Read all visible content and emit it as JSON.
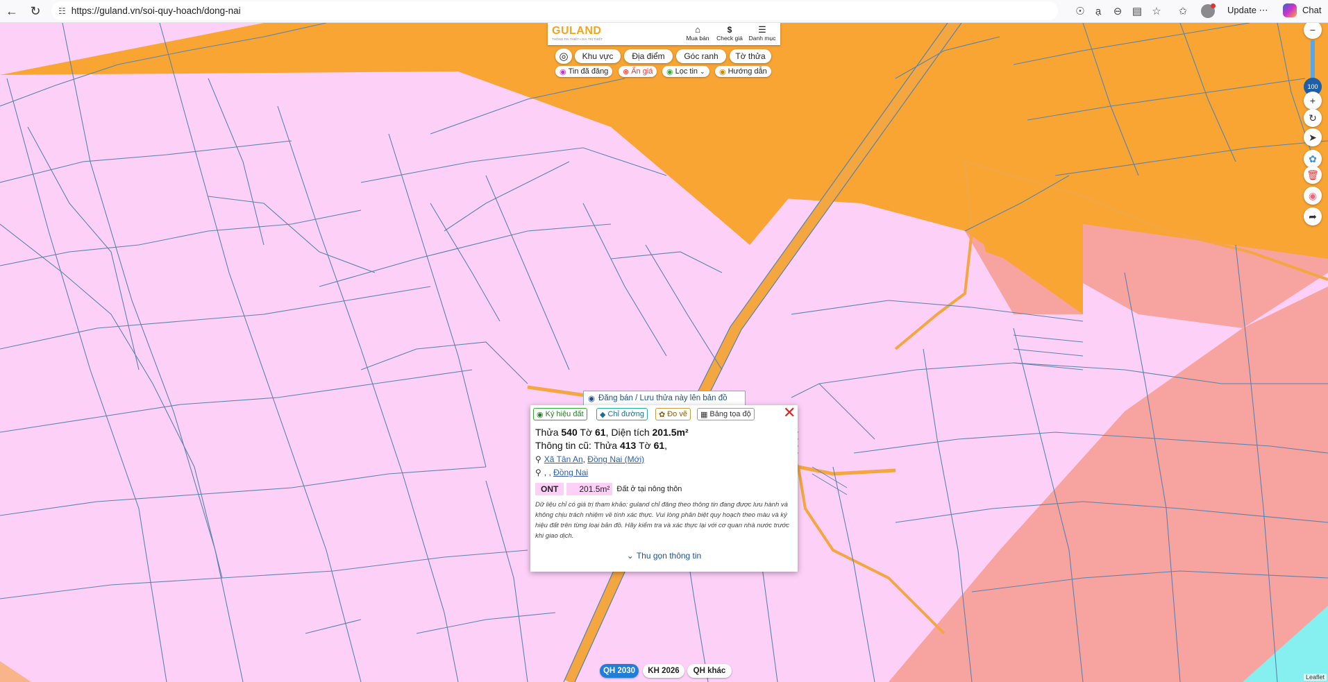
{
  "browser": {
    "url": "https://guland.vn/soi-quy-hoach/dong-nai",
    "update_label": "Update",
    "chat_label": "Chat"
  },
  "header": {
    "logo_text": "GULAND",
    "logo_sub": "THÔNG TIN THIẾT • GIÁ TRỊ THIẾT",
    "menu": [
      {
        "icon": "house-icon",
        "label": "Mua bán"
      },
      {
        "icon": "dollar-icon",
        "label": "Check giá"
      },
      {
        "icon": "menu-icon",
        "label": "Danh mục"
      }
    ]
  },
  "filters": {
    "primary": [
      "Khu vực",
      "Địa điểm",
      "Góc ranh",
      "Tờ thửa"
    ],
    "secondary": [
      "Tin đã đăng",
      "Ẩn giá",
      "Lọc tin",
      "Hướng dẫn"
    ]
  },
  "zoom": {
    "level": "100"
  },
  "save_bar": {
    "label": "Đăng bán / Lưu thửa này lên bản đồ"
  },
  "popup": {
    "tabs": [
      "Ký hiệu đất",
      "Chỉ đường",
      "Đo vẽ",
      "Bảng tọa độ"
    ],
    "line1_prefix": "Thửa ",
    "parcel": "540",
    "line1_mid": " Tờ ",
    "sheet": "61",
    "line1_area_label": ", Diện tích ",
    "area": "201.5m²",
    "line2_prefix": "Thông tin cũ: Thửa ",
    "old_parcel": "413",
    "line2_mid": " Tờ ",
    "old_sheet": "61",
    "line2_suffix": ",",
    "location_commune": "Xã Tân An",
    "location_province": "Đồng Nai (Mới)",
    "location2_prefix": ", , ",
    "location2_province": "Đồng Nai",
    "land_code": "ONT",
    "land_area": "201.5m²",
    "land_desc": "Đất ở tại nông thôn",
    "disclaimer": "Dữ liệu chỉ có giá trị tham khảo: guland chỉ đăng theo thông tin đang được lưu hành và không chịu trách nhiệm về tính xác thực. Vui lòng phân biệt quy hoạch theo màu và ký hiệu đất trên từng loại bản đồ. Hãy kiểm tra và xác thực lại với cơ quan nhà nước trước khi giao dịch.",
    "collapse_label": "Thu gọn thông tin"
  },
  "bottom_tabs": [
    "QH 2030",
    "KH 2026",
    "QH khác"
  ],
  "attribution": "Leaflet",
  "colors": {
    "residential": "#fdd0f8",
    "road_zone": "#f8a534",
    "commercial": "#f7a3a0",
    "water": "#86f0f0",
    "parcel_line": "#5b83aa",
    "road": "#f4a640"
  }
}
